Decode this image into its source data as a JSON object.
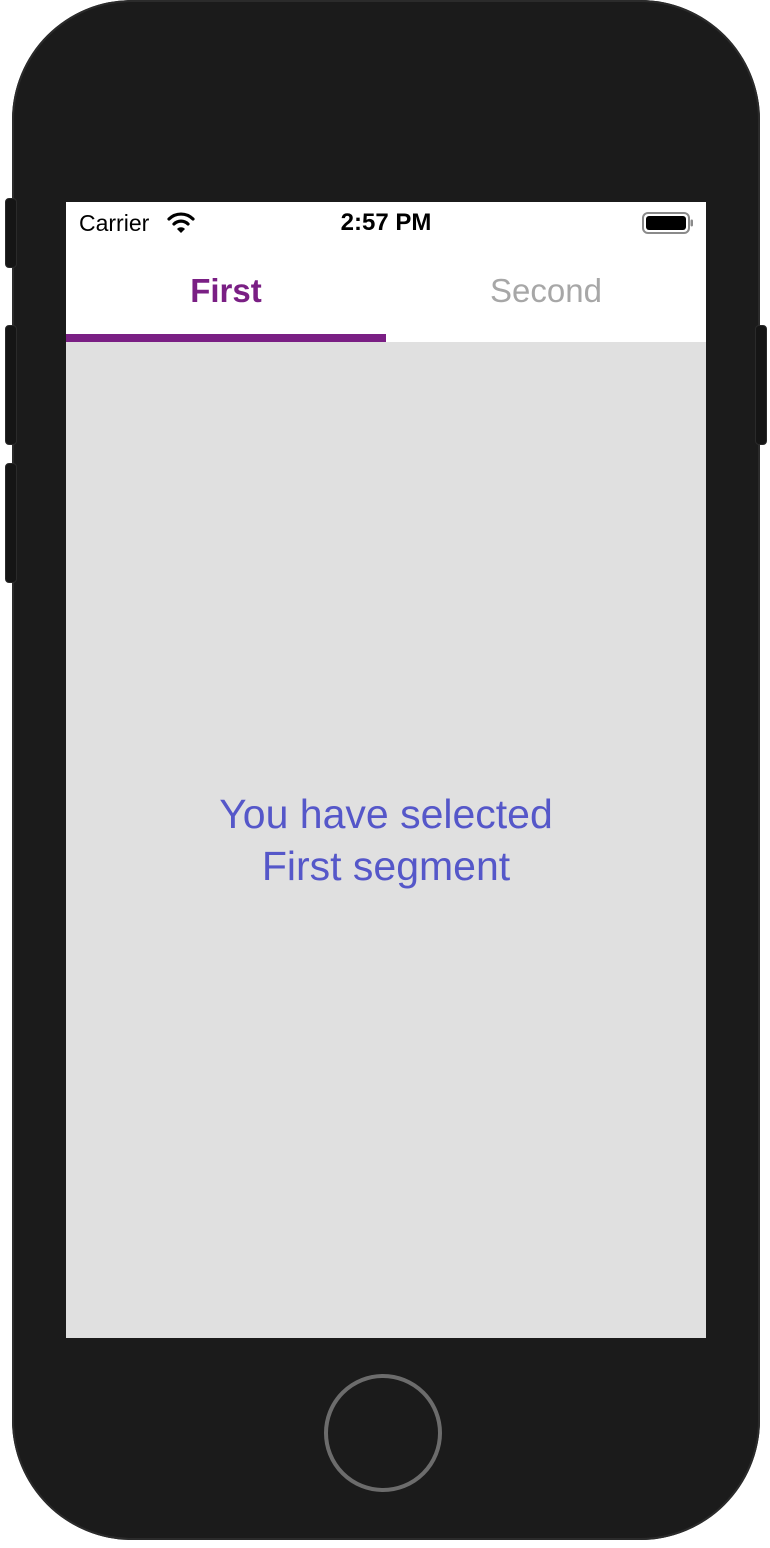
{
  "status_bar": {
    "carrier": "Carrier",
    "time": "2:57 PM",
    "wifi_icon": "wifi-icon",
    "battery_icon": "battery-icon"
  },
  "tabs": [
    {
      "label": "First",
      "active": true
    },
    {
      "label": "Second",
      "active": false
    }
  ],
  "content": {
    "line1": "You have selected",
    "line2": "First segment"
  },
  "colors": {
    "accent": "#7a1f84",
    "message": "#5557c9",
    "inactive_tab": "#a7a7a7",
    "content_background": "#e0e0e0"
  }
}
